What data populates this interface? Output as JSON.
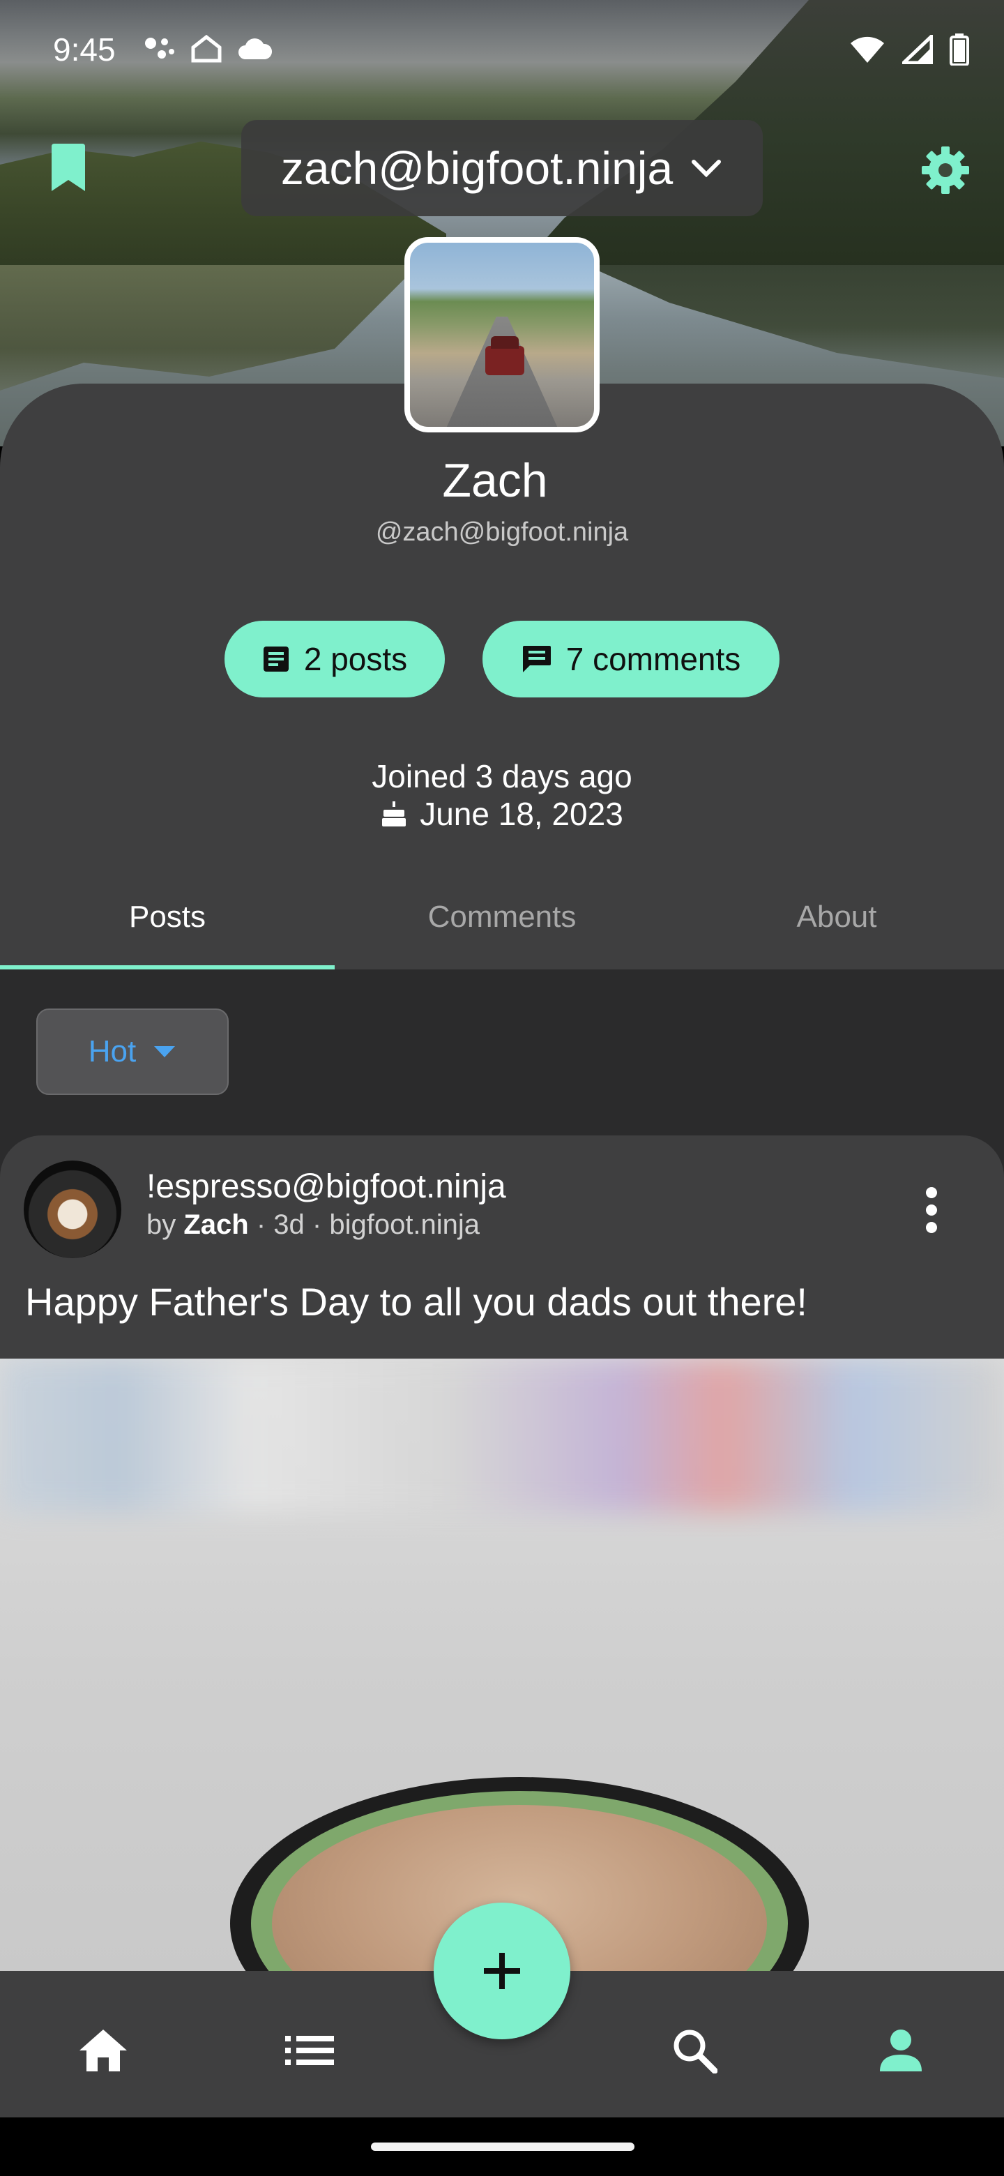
{
  "status_bar": {
    "time": "9:45"
  },
  "header": {
    "account_label": "zach@bigfoot.ninja"
  },
  "profile": {
    "display_name": "Zach",
    "handle": "@zach@bigfoot.ninja",
    "posts_chip": "2 posts",
    "comments_chip": "7 comments",
    "joined": "Joined 3 days ago",
    "cake_day": "June 18, 2023"
  },
  "tabs": [
    {
      "label": "Posts",
      "active": true
    },
    {
      "label": "Comments",
      "active": false
    },
    {
      "label": "About",
      "active": false
    }
  ],
  "feed": {
    "sort_label": "Hot",
    "post": {
      "community": "!espresso@bigfoot.ninja",
      "by_prefix": "by",
      "author": "Zach",
      "meta_suffix": " · 3d · bigfoot.ninja",
      "title": "Happy Father's Day to all you dads out there!"
    }
  },
  "colors": {
    "accent": "#7ff0cc",
    "surface": "#3f3f40",
    "background": "#2b2b2c",
    "sort_text": "#4aa3f0"
  },
  "icons": {
    "bookmark": "bookmark-icon",
    "settings": "gear-icon",
    "dropdown": "chevron-down-icon",
    "posts": "article-icon",
    "comments": "comment-icon",
    "cake": "cake-icon",
    "more": "more-vertical-icon",
    "home": "home-icon",
    "list": "list-icon",
    "add": "plus-icon",
    "search": "search-icon",
    "profile": "person-icon"
  }
}
